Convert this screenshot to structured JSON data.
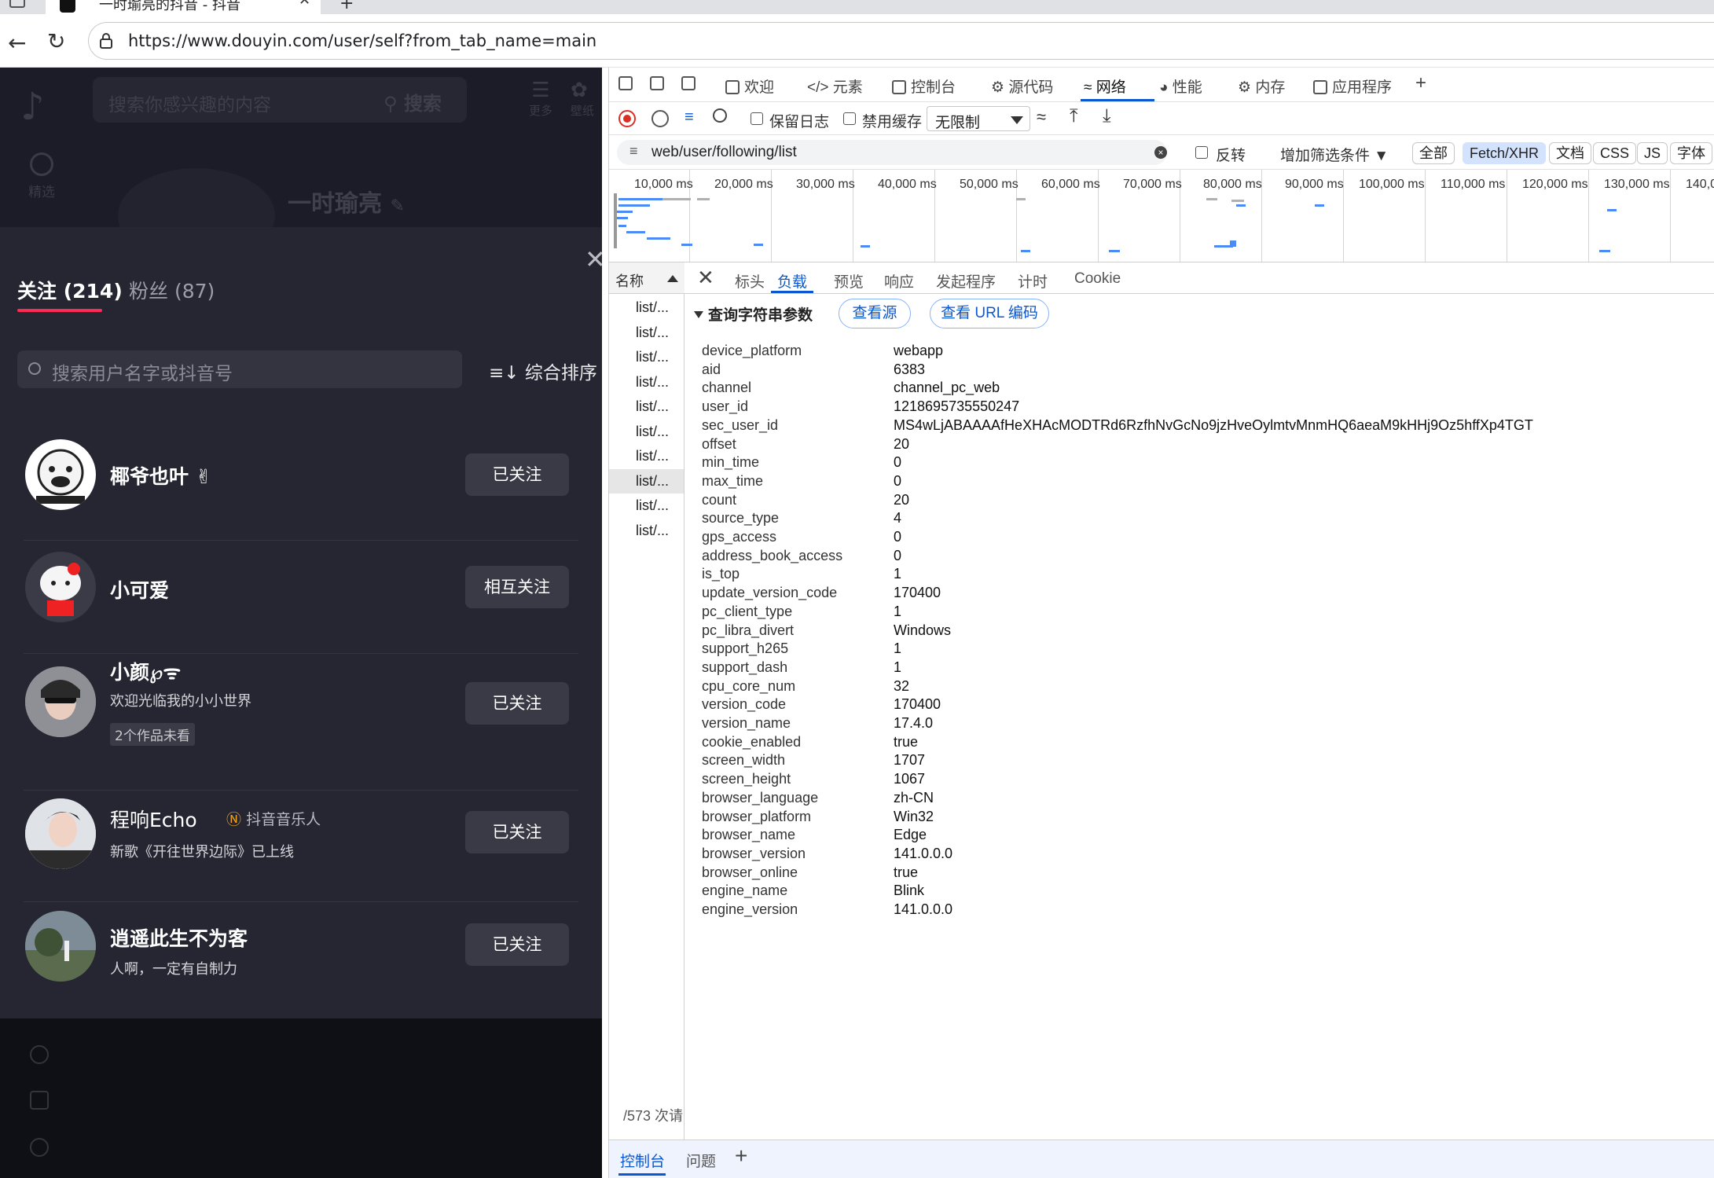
{
  "browser": {
    "tab_title": "一时瑜亮的抖音 - 抖音",
    "tab_close": "✕",
    "new_tab": "+",
    "url": "https://www.douyin.com/user/self?from_tab_name=main"
  },
  "douyin": {
    "search_placeholder": "搜索你感兴趣的内容",
    "search_button": "搜索",
    "more_label": "更多",
    "wallpaper_label": "壁纸",
    "home_label": "精选",
    "profile_name": "一时瑜亮",
    "panel": {
      "tab_following": "关注 (214)",
      "tab_fans": "粉丝 (87)",
      "search_placeholder": "搜索用户名字或抖音号",
      "sort_label": "综合排序",
      "users": [
        {
          "name": "椰爷也叶 ✌",
          "button": "已关注"
        },
        {
          "name": "小可爱",
          "button": "相互关注"
        },
        {
          "name": "小颜℘ᯤ",
          "bio": "欢迎光临我的小小世界",
          "badge": "2个作品未看",
          "button": "已关注"
        },
        {
          "name": "程响Echo",
          "tag": "抖音音乐人",
          "bio": "新歌《开往世界边际》已上线",
          "button": "已关注"
        },
        {
          "name": "逍遥此生不为客",
          "bio": "人啊，一定有自制力",
          "button": "已关注"
        }
      ]
    }
  },
  "devtools": {
    "tabs": [
      "欢迎",
      "元素",
      "控制台",
      "源代码",
      "网络",
      "性能",
      "内存",
      "应用程序"
    ],
    "toolbar": {
      "preserve_log": "保留日志",
      "disable_cache": "禁用缓存",
      "throttle": "无限制"
    },
    "filter": {
      "value": "web/user/following/list",
      "invert": "反转",
      "more_filters": "增加筛选条件",
      "chips": [
        "全部",
        "Fetch/XHR",
        "文档",
        "CSS",
        "JS",
        "字体"
      ],
      "selected_chip": "Fetch/XHR"
    },
    "overview_labels": [
      "10,000 ms",
      "20,000 ms",
      "30,000 ms",
      "40,000 ms",
      "50,000 ms",
      "60,000 ms",
      "70,000 ms",
      "80,000 ms",
      "90,000 ms",
      "100,000 ms",
      "110,000 ms",
      "120,000 ms",
      "130,000 ms",
      "140,0"
    ],
    "request_list": {
      "header": "名称",
      "items": [
        "list/...",
        "list/...",
        "list/...",
        "list/...",
        "list/...",
        "list/...",
        "list/...",
        "list/...",
        "list/...",
        "list/..."
      ],
      "status": "/573 次请"
    },
    "detail_tabs": [
      "标头",
      "负载",
      "预览",
      "响应",
      "发起程序",
      "计时",
      "Cookie"
    ],
    "active_detail_tab": "负载",
    "query_section": {
      "title": "查询字符串参数",
      "view_source": "查看源",
      "view_url_encoded": "查看 URL 编码",
      "params": [
        {
          "key": "device_platform",
          "value": "webapp"
        },
        {
          "key": "aid",
          "value": "6383"
        },
        {
          "key": "channel",
          "value": "channel_pc_web"
        },
        {
          "key": "user_id",
          "value": "1218695735550247"
        },
        {
          "key": "sec_user_id",
          "value": "MS4wLjABAAAAfHeXHAcMODTRd6RzfhNvGcNo9jzHveOylmtvMnmHQ6aeaM9kHHj9Oz5hffXp4TGT"
        },
        {
          "key": "offset",
          "value": "20"
        },
        {
          "key": "min_time",
          "value": "0"
        },
        {
          "key": "max_time",
          "value": "0"
        },
        {
          "key": "count",
          "value": "20"
        },
        {
          "key": "source_type",
          "value": "4"
        },
        {
          "key": "gps_access",
          "value": "0"
        },
        {
          "key": "address_book_access",
          "value": "0"
        },
        {
          "key": "is_top",
          "value": "1"
        },
        {
          "key": "update_version_code",
          "value": "170400"
        },
        {
          "key": "pc_client_type",
          "value": "1"
        },
        {
          "key": "pc_libra_divert",
          "value": "Windows"
        },
        {
          "key": "support_h265",
          "value": "1"
        },
        {
          "key": "support_dash",
          "value": "1"
        },
        {
          "key": "cpu_core_num",
          "value": "32"
        },
        {
          "key": "version_code",
          "value": "170400"
        },
        {
          "key": "version_name",
          "value": "17.4.0"
        },
        {
          "key": "cookie_enabled",
          "value": "true"
        },
        {
          "key": "screen_width",
          "value": "1707"
        },
        {
          "key": "screen_height",
          "value": "1067"
        },
        {
          "key": "browser_language",
          "value": "zh-CN"
        },
        {
          "key": "browser_platform",
          "value": "Win32"
        },
        {
          "key": "browser_name",
          "value": "Edge"
        },
        {
          "key": "browser_version",
          "value": "141.0.0.0"
        },
        {
          "key": "browser_online",
          "value": "true"
        },
        {
          "key": "engine_name",
          "value": "Blink"
        },
        {
          "key": "engine_version",
          "value": "141.0.0.0"
        }
      ]
    },
    "drawer": {
      "console": "控制台",
      "issues": "问题",
      "add": "+"
    }
  }
}
